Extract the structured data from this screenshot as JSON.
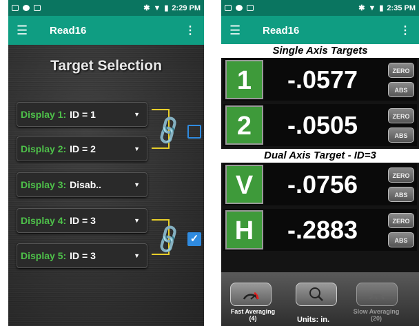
{
  "left": {
    "status": {
      "time": "2:29 PM"
    },
    "appbar": {
      "title": "Read16"
    },
    "screen_title": "Target Selection",
    "displays": [
      {
        "label": "Display 1:",
        "value": "ID = 1"
      },
      {
        "label": "Display 2:",
        "value": "ID = 2"
      },
      {
        "label": "Display 3:",
        "value": "Disab.."
      },
      {
        "label": "Display 4:",
        "value": "ID = 3"
      },
      {
        "label": "Display 5:",
        "value": "ID = 3"
      }
    ],
    "link_checkboxes": [
      {
        "checked": false
      },
      {
        "checked": true
      }
    ]
  },
  "right": {
    "status": {
      "time": "2:35 PM"
    },
    "appbar": {
      "title": "Read16"
    },
    "single_axis_title": "Single Axis Targets",
    "dual_axis_title": "Dual Axis Target - ID=3",
    "rows": [
      {
        "id": "1",
        "value": "-.0577",
        "zero_label": "ZERO",
        "abs_label": "ABS"
      },
      {
        "id": "2",
        "value": "-.0505",
        "zero_label": "ZERO",
        "abs_label": "ABS"
      },
      {
        "id": "V",
        "value": "-.0756",
        "zero_label": "ZERO",
        "abs_label": "ABS"
      },
      {
        "id": "H",
        "value": "-.2883",
        "zero_label": "ZERO",
        "abs_label": "ABS"
      }
    ],
    "fast_averaging": {
      "label": "Fast Averaging",
      "count": "(4)"
    },
    "slow_averaging": {
      "label": "Slow Averaging",
      "count": "(20)"
    },
    "units": "Units: in.",
    "colors": {
      "accent": "#0f9d82",
      "status": "#0a7560",
      "id_green": "#3e9a3a",
      "link_yellow": "#e8cf2a",
      "check_blue": "#2f8be0"
    }
  }
}
